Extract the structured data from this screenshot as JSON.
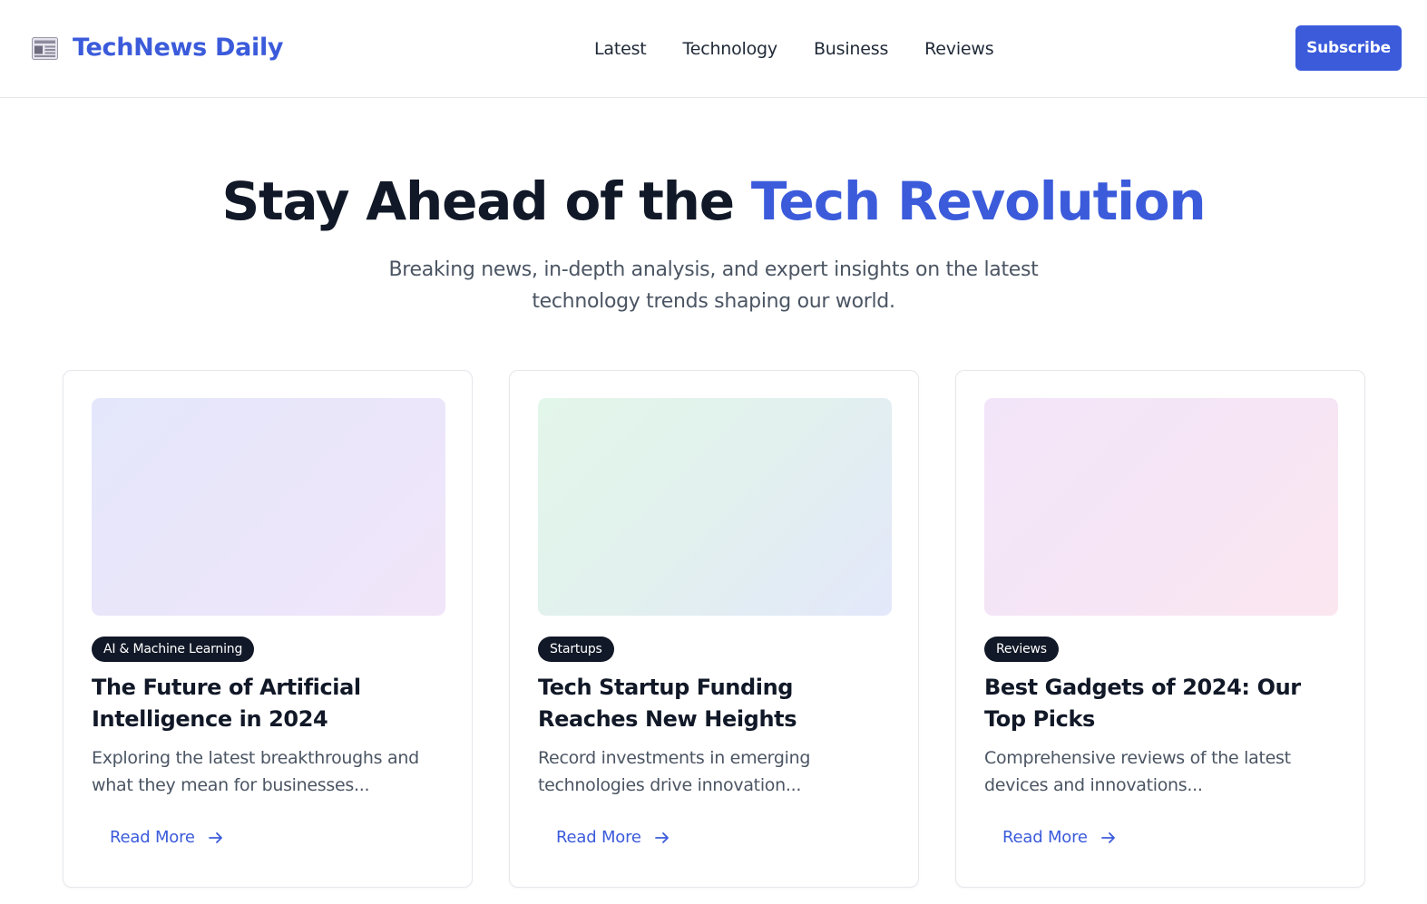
{
  "header": {
    "logo_icon": "newspaper-icon",
    "brand": "TechNews Daily",
    "nav": [
      {
        "label": "Latest"
      },
      {
        "label": "Technology"
      },
      {
        "label": "Business"
      },
      {
        "label": "Reviews"
      }
    ],
    "subscribe_label": "Subscribe"
  },
  "hero": {
    "title_main": "Stay Ahead of the ",
    "title_accent": "Tech Revolution",
    "subtitle": "Breaking news, in-depth analysis, and expert insights on the latest technology trends shaping our world."
  },
  "cards": [
    {
      "category": "AI & Machine Learning",
      "title": "The Future of Artificial Intelligence in 2024",
      "excerpt": "Exploring the latest breakthroughs and what they mean for businesses...",
      "cta": "Read More"
    },
    {
      "category": "Startups",
      "title": "Tech Startup Funding Reaches New Heights",
      "excerpt": "Record investments in emerging technologies drive innovation...",
      "cta": "Read More"
    },
    {
      "category": "Reviews",
      "title": "Best Gadgets of 2024: Our Top Picks",
      "excerpt": "Comprehensive reviews of the latest devices and innovations...",
      "cta": "Read More"
    }
  ],
  "colors": {
    "accent": "#3b5bdb",
    "text_dark": "#111827",
    "text_muted": "#4b5563",
    "badge_bg": "#111827"
  }
}
